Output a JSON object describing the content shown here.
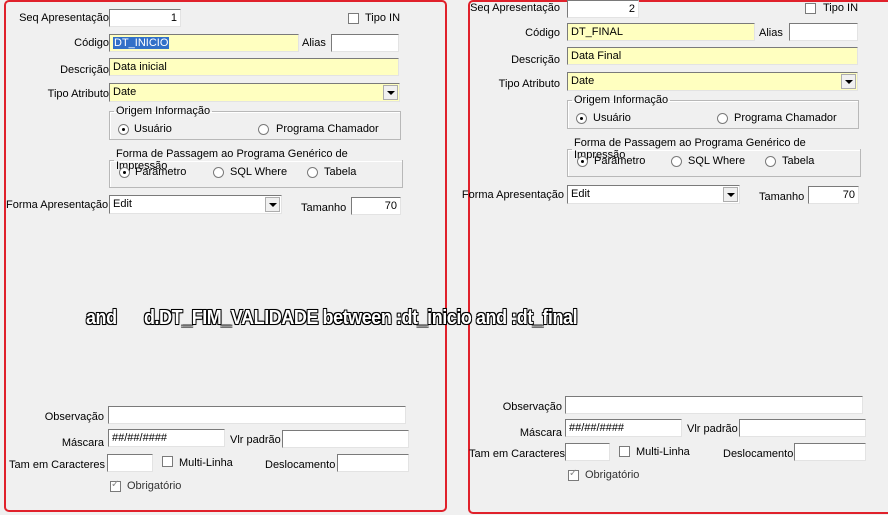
{
  "left": {
    "seq_label": "Seq Apresentação",
    "seq_value": "1",
    "tipo_in_label": "Tipo IN",
    "codigo_label": "Código",
    "codigo_value": "DT_INICIO",
    "alias_label": "Alias",
    "alias_value": "",
    "descricao_label": "Descrição",
    "descricao_value": "Data inicial",
    "tipo_atributo_label": "Tipo Atributo",
    "tipo_atributo_value": "Date",
    "origem_legend": "Origem Informação",
    "origem_opt1": "Usuário",
    "origem_opt2": "Programa Chamador",
    "forma_legend": "Forma de Passagem ao Programa Genérico de Impressão",
    "forma_opt1": "Parâmetro",
    "forma_opt2": "SQL Where",
    "forma_opt3": "Tabela",
    "forma_apres_label": "Forma Apresentação",
    "forma_apres_value": "Edit",
    "tamanho_label": "Tamanho",
    "tamanho_value": "70",
    "observacao_label": "Observação",
    "observacao_value": "",
    "mascara_label": "Máscara",
    "mascara_value": "##/##/####",
    "vlr_padrao_label": "Vlr padrão",
    "vlr_padrao_value": "",
    "tam_caracteres_label": "Tam em Caracteres",
    "tam_caracteres_value": "",
    "multilinha_label": "Multi-Linha",
    "deslocamento_label": "Deslocamento",
    "deslocamento_value": "",
    "obrigatorio_label": "Obrigatório"
  },
  "right": {
    "seq_label": "Seq Apresentação",
    "seq_value": "2",
    "tipo_in_label": "Tipo IN",
    "codigo_label": "Código",
    "codigo_value": "DT_FINAL",
    "alias_label": "Alias",
    "alias_value": "",
    "descricao_label": "Descrição",
    "descricao_value": "Data Final",
    "tipo_atributo_label": "Tipo Atributo",
    "tipo_atributo_value": "Date",
    "origem_legend": "Origem Informação",
    "origem_opt1": "Usuário",
    "origem_opt2": "Programa Chamador",
    "forma_legend": "Forma de Passagem ao Programa Genérico de Impressão",
    "forma_opt1": "Parâmetro",
    "forma_opt2": "SQL Where",
    "forma_opt3": "Tabela",
    "forma_apres_label": "Forma Apresentação",
    "forma_apres_value": "Edit",
    "tamanho_label": "Tamanho",
    "tamanho_value": "70",
    "observacao_label": "Observação",
    "observacao_value": "",
    "mascara_label": "Máscara",
    "mascara_value": "##/##/####",
    "vlr_padrao_label": "Vlr padrão",
    "vlr_padrao_value": "",
    "tam_caracteres_label": "Tam em Caracteres",
    "tam_caracteres_value": "",
    "multilinha_label": "Multi-Linha",
    "deslocamento_label": "Deslocamento",
    "deslocamento_value": "",
    "obrigatorio_label": "Obrigatório"
  },
  "overlay_text": "and      d.DT_FIM_VALIDADE between :dt_inicio and :dt_final",
  "colors": {
    "highlight_border": "#e0212b",
    "required_field": "#ffffc0",
    "selection": "#3270c8"
  }
}
